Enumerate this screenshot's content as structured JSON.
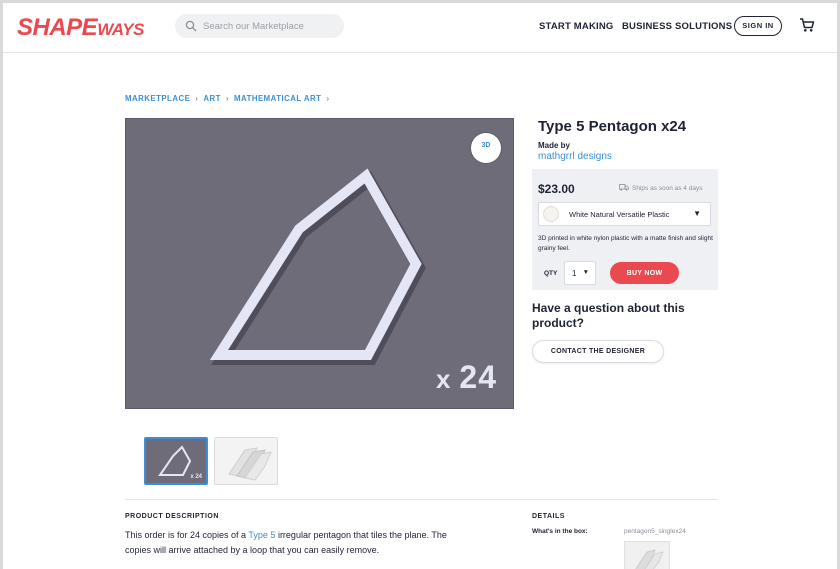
{
  "header": {
    "logo_main": "SHAPE",
    "logo_sub": "WAYS",
    "search_placeholder": "Search our Marketplace",
    "nav": [
      "START MAKING",
      "BUSINESS SOLUTIONS"
    ],
    "signin_label": "SIGN IN"
  },
  "breadcrumb": [
    "MARKETPLACE",
    "ART",
    "MATHEMATICAL ART"
  ],
  "product": {
    "title": "Type 5 Pentagon x24",
    "made_by_label": "Made by",
    "designer": "mathgrrl designs",
    "image_multiplier_x": "x",
    "image_multiplier_n": "24",
    "thumb_multiplier": "x 24",
    "view_3d_label": "3D"
  },
  "buy_box": {
    "price": "$23.00",
    "ships": "Ships as soon as 4 days",
    "material": "White Natural Versatile Plastic",
    "material_desc": "3D printed in white nylon plastic with a matte finish and slight grainy feel.",
    "qty_label": "QTY",
    "qty_value": "1",
    "buy_label": "BUY NOW"
  },
  "question": {
    "text": "Have a question about this product?",
    "contact_label": "CONTACT THE DESIGNER"
  },
  "description": {
    "heading": "PRODUCT DESCRIPTION",
    "before_link": "This order is for 24 copies of a ",
    "link": "Type 5",
    "after_link": " irregular pentagon that tiles the plane.  The copies will arrive attached by a loop that you can easily remove."
  },
  "details": {
    "heading": "DETAILS",
    "box_label": "What's in the box:",
    "box_file": "pentagon5_singlex24"
  },
  "colors": {
    "brand": "#ea4a4f",
    "link": "#3a8fd8",
    "image_bg": "#6e6c78"
  }
}
